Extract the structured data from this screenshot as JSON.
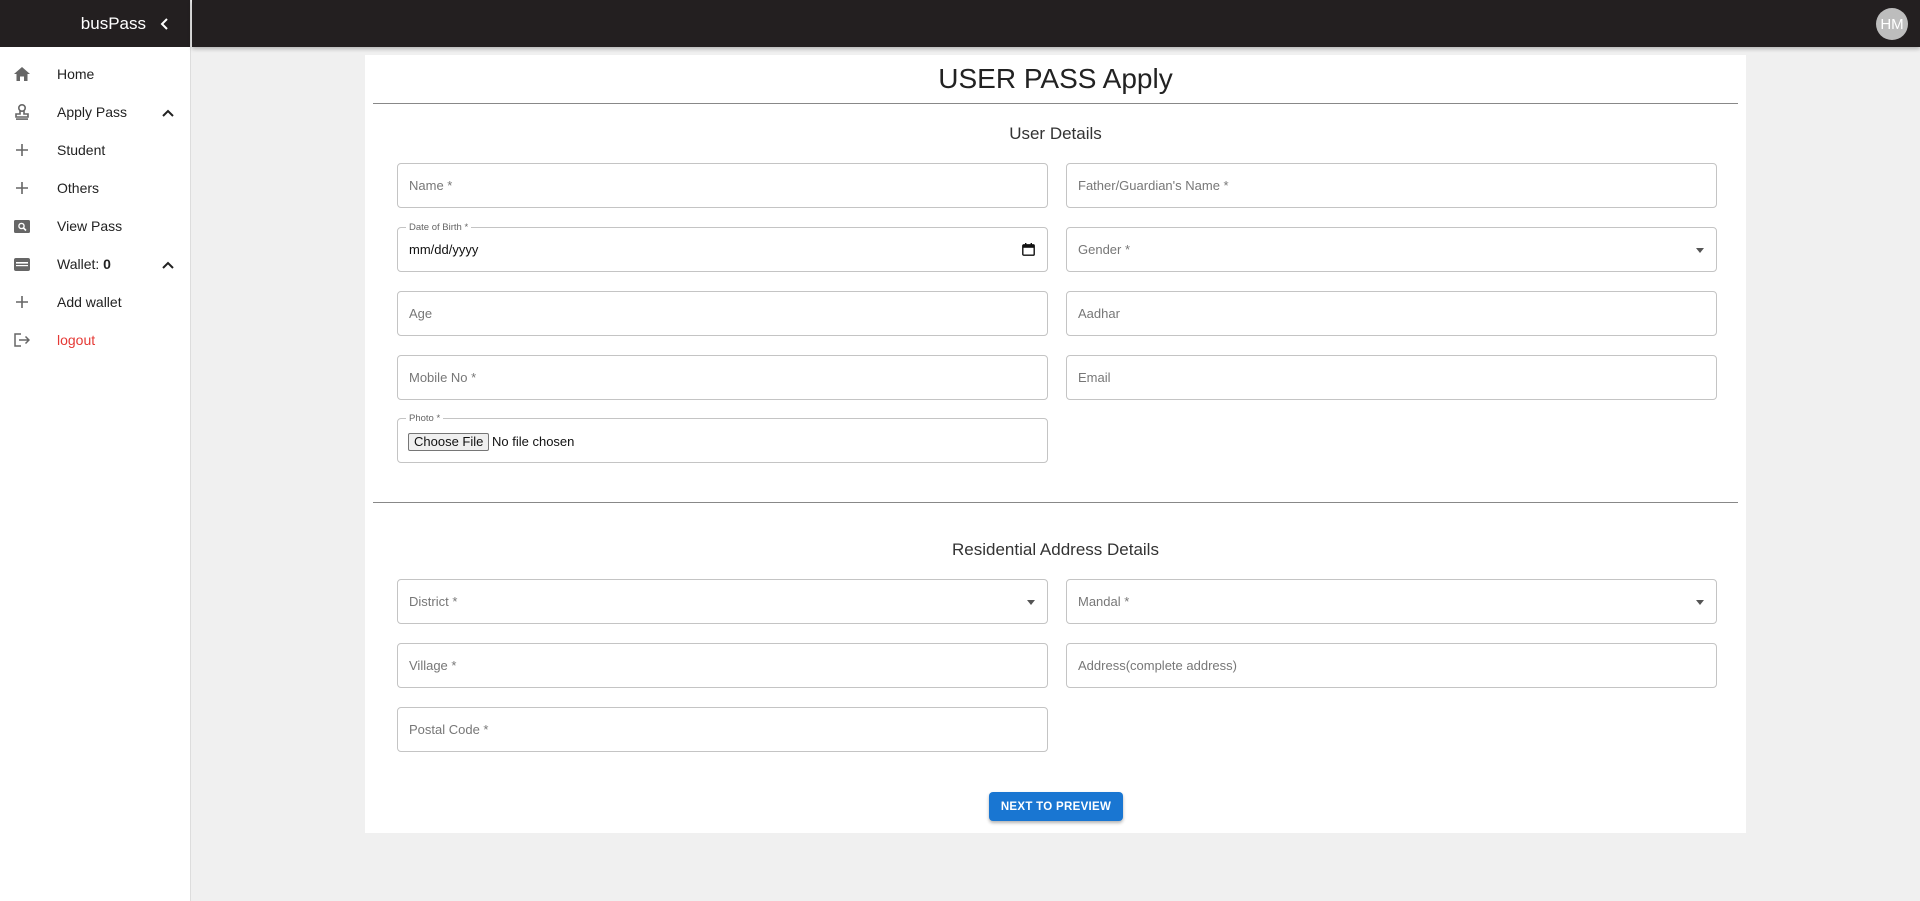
{
  "app": {
    "brand": "busPass",
    "user_initials": "HM"
  },
  "sidebar": {
    "items": [
      {
        "label": "Home",
        "icon": "home-icon"
      },
      {
        "label": "Apply Pass",
        "icon": "stamp-icon"
      },
      {
        "label": "Student",
        "icon": "plus-icon"
      },
      {
        "label": "Others",
        "icon": "plus-icon"
      },
      {
        "label": "View Pass",
        "icon": "search-pass-icon"
      },
      {
        "label": "Wallet: ",
        "value": "0",
        "icon": "wallet-icon"
      },
      {
        "label": "Add wallet",
        "icon": "plus-icon"
      },
      {
        "label": "logout",
        "icon": "logout-icon"
      }
    ]
  },
  "form": {
    "title": "USER PASS Apply",
    "user_section_title": "User Details",
    "address_section_title": "Residential Address Details",
    "name": "Name *",
    "father_name": "Father/Guardian's Name *",
    "dob_label": "Date of Birth *",
    "dob_value": "mm/dd/yyyy",
    "gender": "Gender *",
    "age": "Age",
    "aadhar": "Aadhar",
    "mobile": "Mobile No *",
    "email": "Email",
    "photo_label": "Photo *",
    "photo_button": "Choose File",
    "photo_status": "No file chosen",
    "district": "District *",
    "mandal": "Mandal *",
    "village": "Village *",
    "address": "Address(complete address)",
    "postal_code": "Postal Code *",
    "next_button": "NEXT TO PREVIEW"
  },
  "colors": {
    "topbar": "#231f20",
    "primary_button": "#1976d2",
    "logout": "#e53935"
  }
}
